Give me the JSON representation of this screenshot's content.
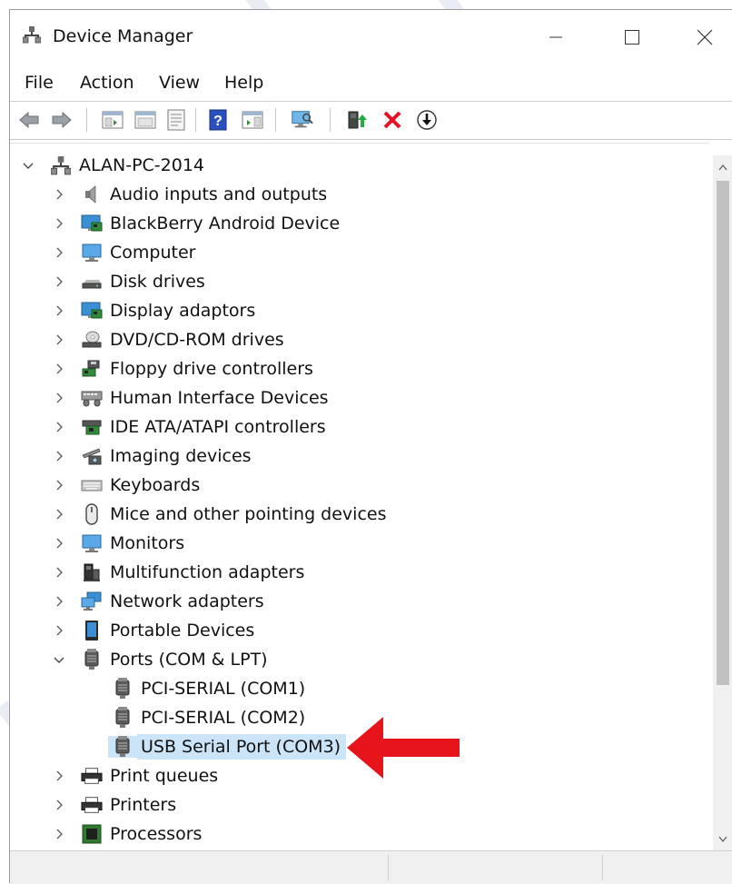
{
  "window": {
    "title": "Device Manager",
    "controls": {
      "minimize": "minimize",
      "maximize": "maximize",
      "close": "close"
    }
  },
  "menu": [
    "File",
    "Action",
    "View",
    "Help"
  ],
  "toolbar": [
    "back-icon",
    "forward-icon",
    "show-hide-console-tree-icon",
    "properties-icon",
    "help-icon",
    "action-pane-icon",
    "scan-hardware-icon",
    "update-driver-icon",
    "uninstall-icon",
    "disable-device-icon"
  ],
  "tree": {
    "root": "ALAN-PC-2014",
    "categories": [
      {
        "label": "Audio inputs and outputs",
        "icon": "speaker-icon",
        "expanded": false
      },
      {
        "label": "BlackBerry Android Device",
        "icon": "monitor-board-icon",
        "expanded": false
      },
      {
        "label": "Computer",
        "icon": "computer-icon",
        "expanded": false
      },
      {
        "label": "Disk drives",
        "icon": "disk-drive-icon",
        "expanded": false
      },
      {
        "label": "Display adaptors",
        "icon": "display-adapter-icon",
        "expanded": false
      },
      {
        "label": "DVD/CD-ROM drives",
        "icon": "dvd-drive-icon",
        "expanded": false
      },
      {
        "label": "Floppy drive controllers",
        "icon": "floppy-controller-icon",
        "expanded": false
      },
      {
        "label": "Human Interface Devices",
        "icon": "hid-icon",
        "expanded": false
      },
      {
        "label": "IDE ATA/ATAPI controllers",
        "icon": "ide-controller-icon",
        "expanded": false
      },
      {
        "label": "Imaging devices",
        "icon": "camera-icon",
        "expanded": false
      },
      {
        "label": "Keyboards",
        "icon": "keyboard-icon",
        "expanded": false
      },
      {
        "label": "Mice and other pointing devices",
        "icon": "mouse-icon",
        "expanded": false
      },
      {
        "label": "Monitors",
        "icon": "monitor-icon",
        "expanded": false
      },
      {
        "label": "Multifunction adapters",
        "icon": "multifunction-icon",
        "expanded": false
      },
      {
        "label": "Network adapters",
        "icon": "network-icon",
        "expanded": false
      },
      {
        "label": "Portable Devices",
        "icon": "portable-device-icon",
        "expanded": false
      },
      {
        "label": "Ports (COM & LPT)",
        "icon": "port-icon",
        "expanded": true,
        "children": [
          {
            "label": "PCI-SERIAL (COM1)",
            "icon": "port-icon",
            "selected": false
          },
          {
            "label": "PCI-SERIAL (COM2)",
            "icon": "port-icon",
            "selected": false
          },
          {
            "label": "USB Serial Port (COM3)",
            "icon": "port-icon",
            "selected": true
          }
        ]
      },
      {
        "label": "Print queues",
        "icon": "printer-icon",
        "expanded": false
      },
      {
        "label": "Printers",
        "icon": "printer-icon",
        "expanded": false
      },
      {
        "label": "Processors",
        "icon": "processor-icon",
        "expanded": false
      }
    ]
  },
  "annotation": {
    "type": "arrow",
    "color": "#e8141c",
    "points_to": "USB Serial Port (COM3)"
  },
  "colors": {
    "selection": "#cce4f7",
    "accent": "#0078d7",
    "uninstall": "#e81123"
  }
}
